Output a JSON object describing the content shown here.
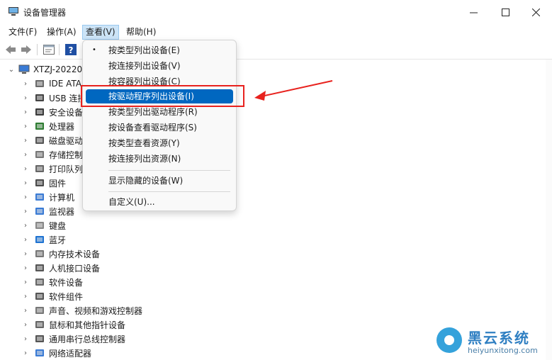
{
  "window": {
    "title": "设备管理器",
    "minimize_icon": "minimize-icon",
    "maximize_icon": "maximize-icon",
    "close_icon": "close-icon"
  },
  "menubar": {
    "items": [
      {
        "label": "文件(F)"
      },
      {
        "label": "操作(A)"
      },
      {
        "label": "查看(V)"
      },
      {
        "label": "帮助(H)"
      }
    ]
  },
  "toolbar": {
    "icons": [
      "back-arrow-icon",
      "forward-arrow-icon",
      "properties-icon",
      "help-icon"
    ]
  },
  "tree": {
    "root": {
      "label": "XTZJ-20220"
    },
    "nodes": [
      {
        "label": "IDE ATA",
        "icon": "ide-ata-icon"
      },
      {
        "label": "USB 连接",
        "icon": "usb-icon"
      },
      {
        "label": "安全设备",
        "icon": "security-device-icon"
      },
      {
        "label": "处理器",
        "icon": "processor-icon"
      },
      {
        "label": "磁盘驱动",
        "icon": "disk-drive-icon"
      },
      {
        "label": "存储控制",
        "icon": "storage-controller-icon"
      },
      {
        "label": "打印队列",
        "icon": "print-queue-icon"
      },
      {
        "label": "固件",
        "icon": "firmware-icon"
      },
      {
        "label": "计算机",
        "icon": "computer-icon"
      },
      {
        "label": "监视器",
        "icon": "monitor-icon"
      },
      {
        "label": "键盘",
        "icon": "keyboard-icon"
      },
      {
        "label": "蓝牙",
        "icon": "bluetooth-icon"
      },
      {
        "label": "内存技术设备",
        "icon": "memory-tech-icon"
      },
      {
        "label": "人机接口设备",
        "icon": "hid-icon"
      },
      {
        "label": "软件设备",
        "icon": "software-device-icon"
      },
      {
        "label": "软件组件",
        "icon": "software-component-icon"
      },
      {
        "label": "声音、视频和游戏控制器",
        "icon": "sound-icon"
      },
      {
        "label": "鼠标和其他指针设备",
        "icon": "mouse-icon"
      },
      {
        "label": "通用串行总线控制器",
        "icon": "usb-controller-icon"
      },
      {
        "label": "网络适配器",
        "icon": "network-adapter-icon"
      }
    ]
  },
  "view_menu": {
    "items": [
      {
        "label": "按类型列出设备(E)",
        "checked": true
      },
      {
        "label": "按连接列出设备(V)"
      },
      {
        "label": "按容器列出设备(C)"
      },
      {
        "label": "按驱动程序列出设备(I)",
        "highlighted": true
      },
      {
        "label": "按类型列出驱动程序(R)"
      },
      {
        "label": "按设备查看驱动程序(S)"
      },
      {
        "label": "按类型查看资源(Y)"
      },
      {
        "label": "按连接列出资源(N)"
      },
      {
        "label": "显示隐藏的设备(W)"
      },
      {
        "label": "自定义(U)..."
      }
    ],
    "bullet": "•"
  },
  "annotation": {
    "color": "#e8221e"
  },
  "watermark": {
    "title": "黑云系统",
    "url": "heiyunxitong.com"
  }
}
